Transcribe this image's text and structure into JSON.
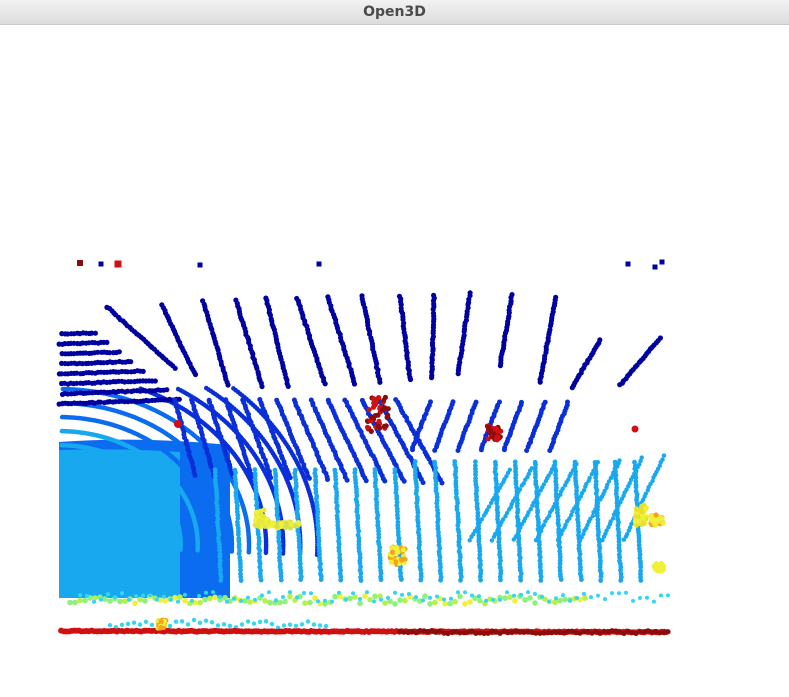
{
  "window": {
    "title": "Open3D"
  },
  "viewport": {
    "background_color": "#ffffff",
    "colormap": "jet",
    "colormap_colors": [
      "#0000a0",
      "#0a2fd8",
      "#0b6cf0",
      "#18a8f0",
      "#33d6f6",
      "#8ef27a",
      "#f0f03a",
      "#f6a21c",
      "#d01010",
      "#8c0c0c"
    ]
  }
}
